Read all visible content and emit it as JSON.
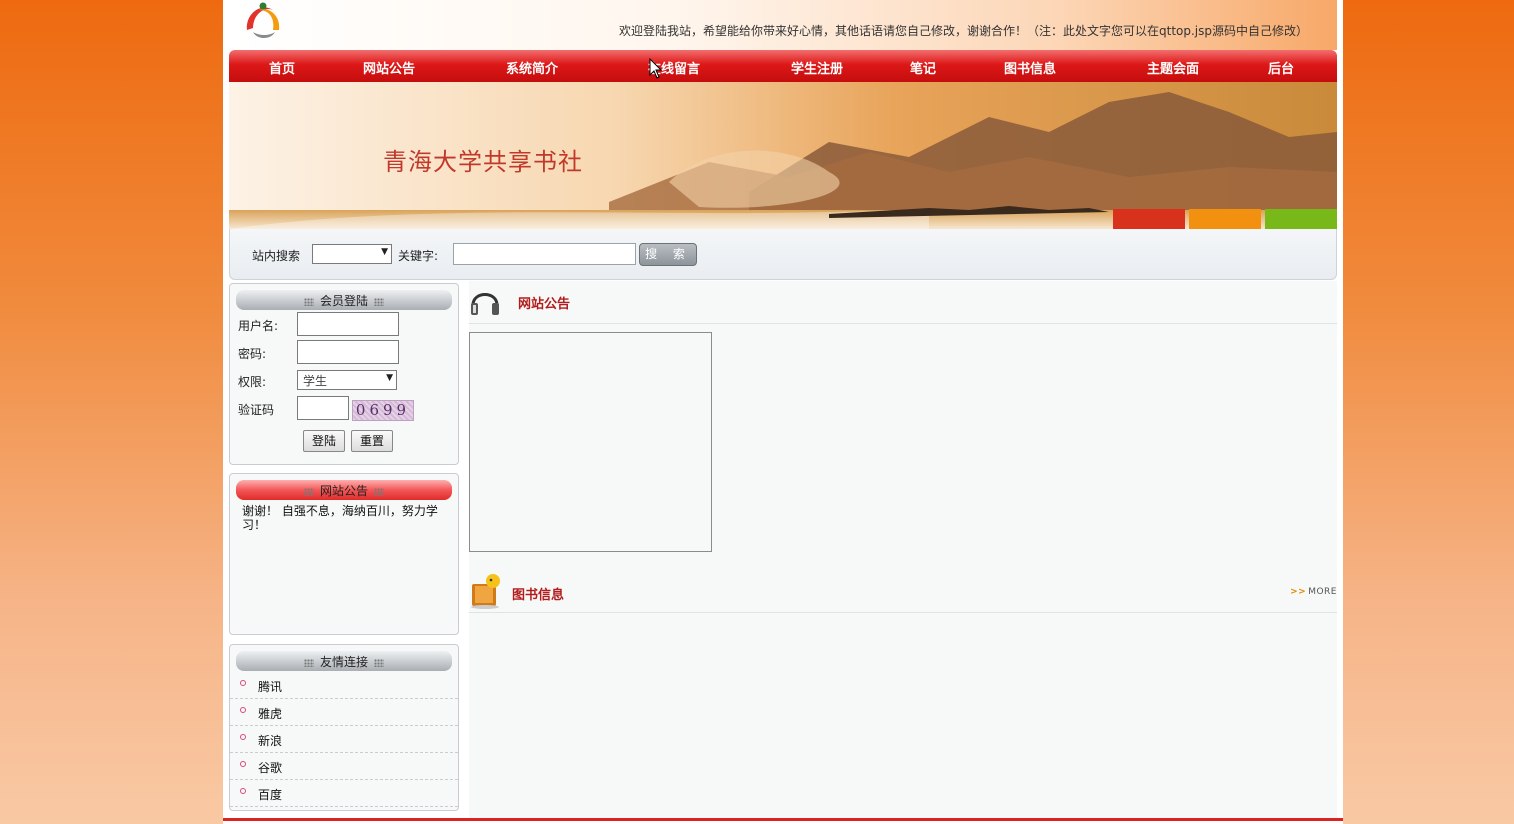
{
  "header": {
    "welcome_text": "欢迎登陆我站，希望能给你带来好心情，其他话语请您自己修改，谢谢合作！（注：此处文字您可以在qttop.jsp源码中自己修改）"
  },
  "nav": {
    "items": [
      "首页",
      "网站公告",
      "系统简介",
      "在线留言",
      "学生注册",
      "笔记",
      "图书信息",
      "主题会面",
      "后台"
    ]
  },
  "banner": {
    "title": "青海大学共享书社"
  },
  "search": {
    "site_search_label": "站内搜索",
    "select_value": "",
    "keyword_label": "关键字:",
    "keyword_value": "",
    "button_label": "搜 索"
  },
  "login": {
    "title": "会员登陆",
    "username_label": "用户名:",
    "password_label": "密码:",
    "role_label": "权限:",
    "role_value": "学生",
    "captcha_label": "验证码",
    "captcha_value": "0699",
    "login_button": "登陆",
    "reset_button": "重置"
  },
  "notice_panel": {
    "title": "网站公告",
    "text": "谢谢！       自强不息，海纳百川，努力学习！"
  },
  "links_panel": {
    "title": "友情连接",
    "items": [
      "腾讯",
      "雅虎",
      "新浪",
      "谷歌",
      "百度"
    ]
  },
  "main": {
    "notice_title": "网站公告",
    "books_title": "图书信息",
    "more_label": "MORE"
  },
  "colors": {
    "nav_red": "#d81a1a",
    "title_red": "#b21c1c",
    "page_orange": "#ee6a10"
  }
}
